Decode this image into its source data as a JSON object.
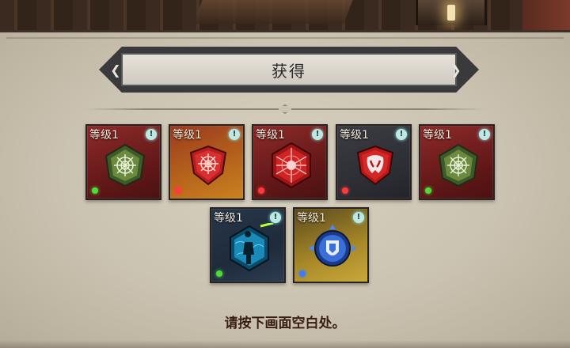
{
  "title": "获得",
  "hint": "请按下画面空白处。",
  "items": [
    {
      "level": "等级1",
      "info": "!",
      "bg": "red",
      "dot": "green",
      "icon": "green-web-rune-icon"
    },
    {
      "level": "等级1",
      "info": "!",
      "bg": "orange",
      "dot": "red",
      "icon": "red-web-shield-icon"
    },
    {
      "level": "等级1",
      "info": "!",
      "bg": "red",
      "dot": "red",
      "icon": "red-star-crystal-icon"
    },
    {
      "level": "等级1",
      "info": "!",
      "bg": "slate",
      "dot": "red",
      "icon": "red-mask-shield-icon"
    },
    {
      "level": "等级1",
      "info": "!",
      "bg": "red",
      "dot": "green",
      "icon": "green-web-rune-icon"
    },
    {
      "level": "等级1",
      "info": "!",
      "bg": "navy",
      "dot": "green",
      "icon": "blue-silhouette-hex-icon"
    },
    {
      "level": "等级1",
      "info": "!",
      "bg": "gold",
      "dot": "blue",
      "icon": "blue-crest-orb-icon"
    }
  ]
}
